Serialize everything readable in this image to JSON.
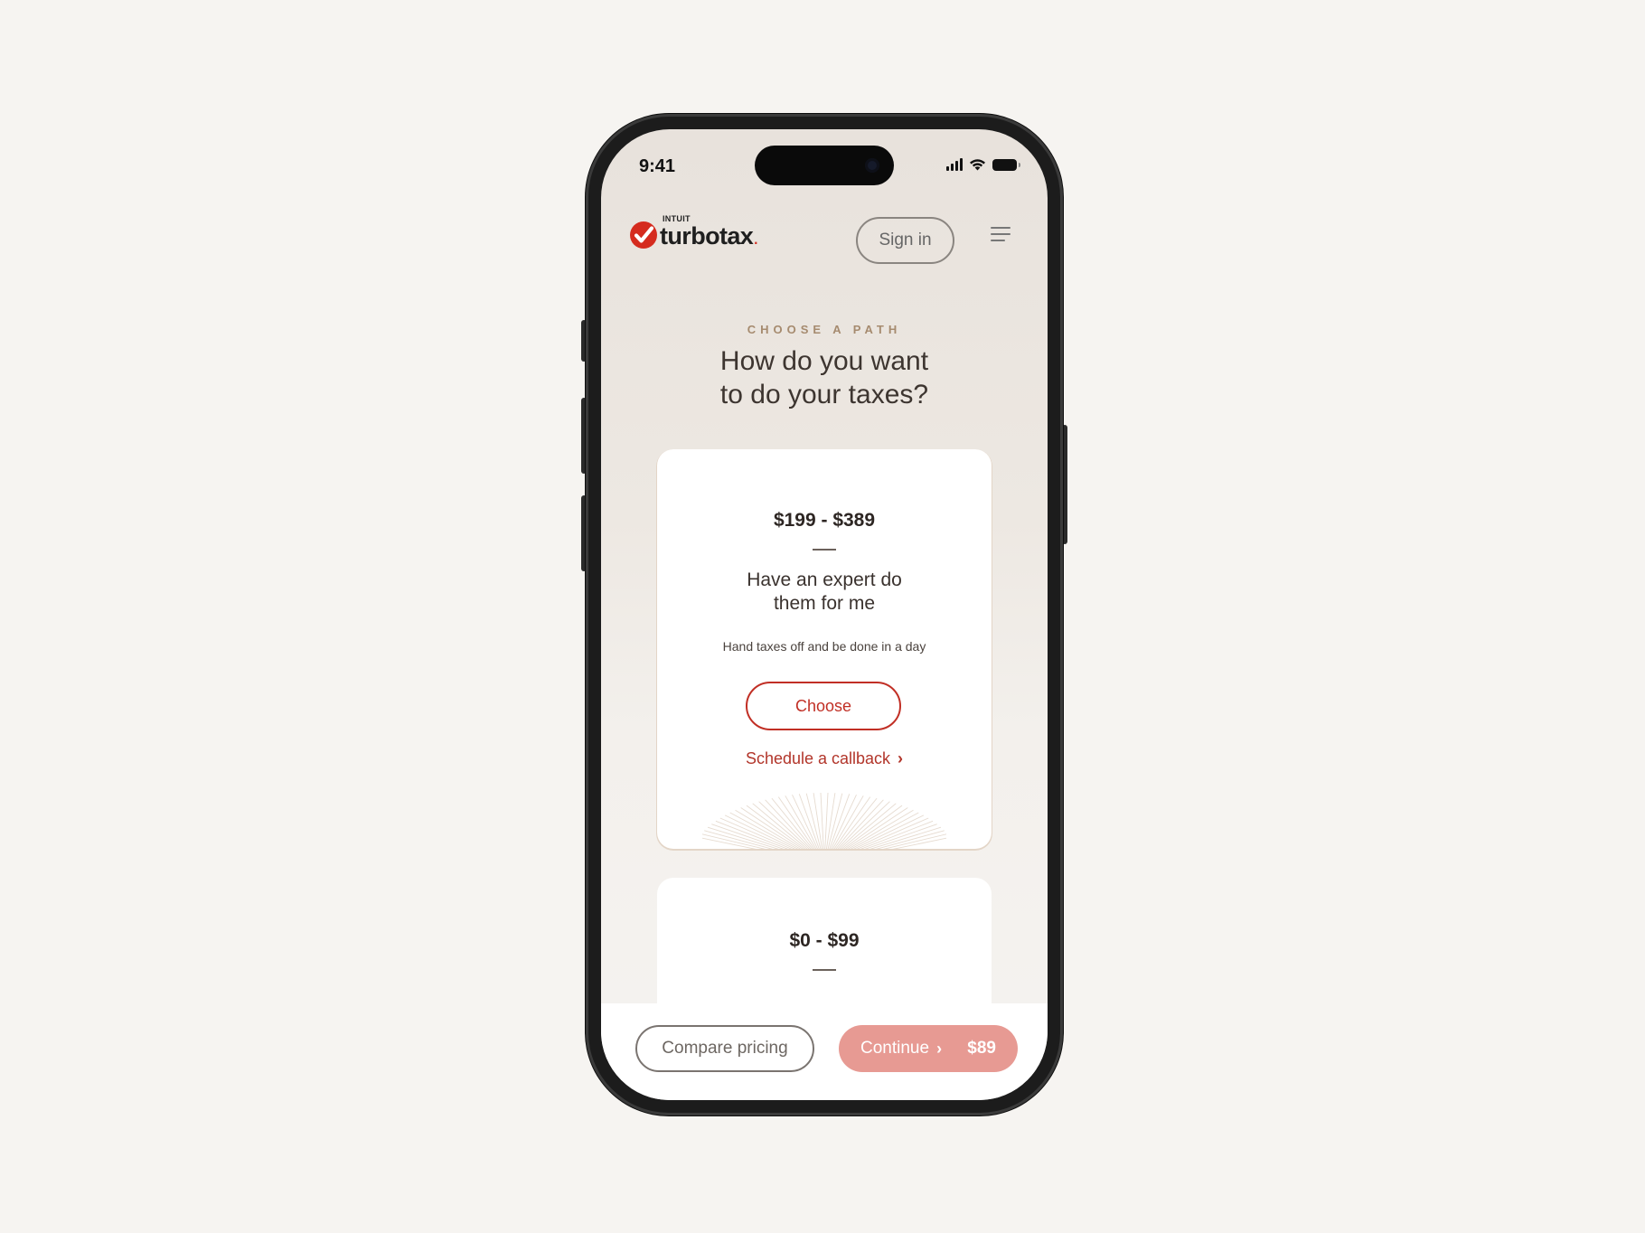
{
  "status_bar": {
    "time": "9:41"
  },
  "header": {
    "logo": {
      "brand_small": "INTUIT",
      "brand_name": "turbotax",
      "brand_dot": "."
    },
    "sign_in_label": "Sign in"
  },
  "hero": {
    "eyebrow": "CHOOSE A PATH",
    "title_line1": "How do you want",
    "title_line2": "to do your taxes?"
  },
  "cards": [
    {
      "price": "$199 - $389",
      "title_line1": "Have an expert do",
      "title_line2": "them for me",
      "subtitle": "Hand taxes off and be done in a day",
      "choose_label": "Choose",
      "callback_label": "Schedule a callback",
      "callback_chevron": "›"
    },
    {
      "price": "$0 - $99"
    }
  ],
  "bottom_bar": {
    "compare_label": "Compare pricing",
    "continue_label": "Continue",
    "continue_chevron": "›",
    "continue_price": "$89"
  },
  "colors": {
    "brand_red": "#d52b1e",
    "accent_red": "#c12f25",
    "continue_button": "#e79a93",
    "eyebrow_tan": "#a68b6f",
    "page_background": "#f6f4f1"
  },
  "icons": [
    "turbotax-check-logo-icon",
    "signal-icon",
    "wifi-icon",
    "battery-icon",
    "hamburger-menu-icon",
    "chevron-right-icon"
  ]
}
